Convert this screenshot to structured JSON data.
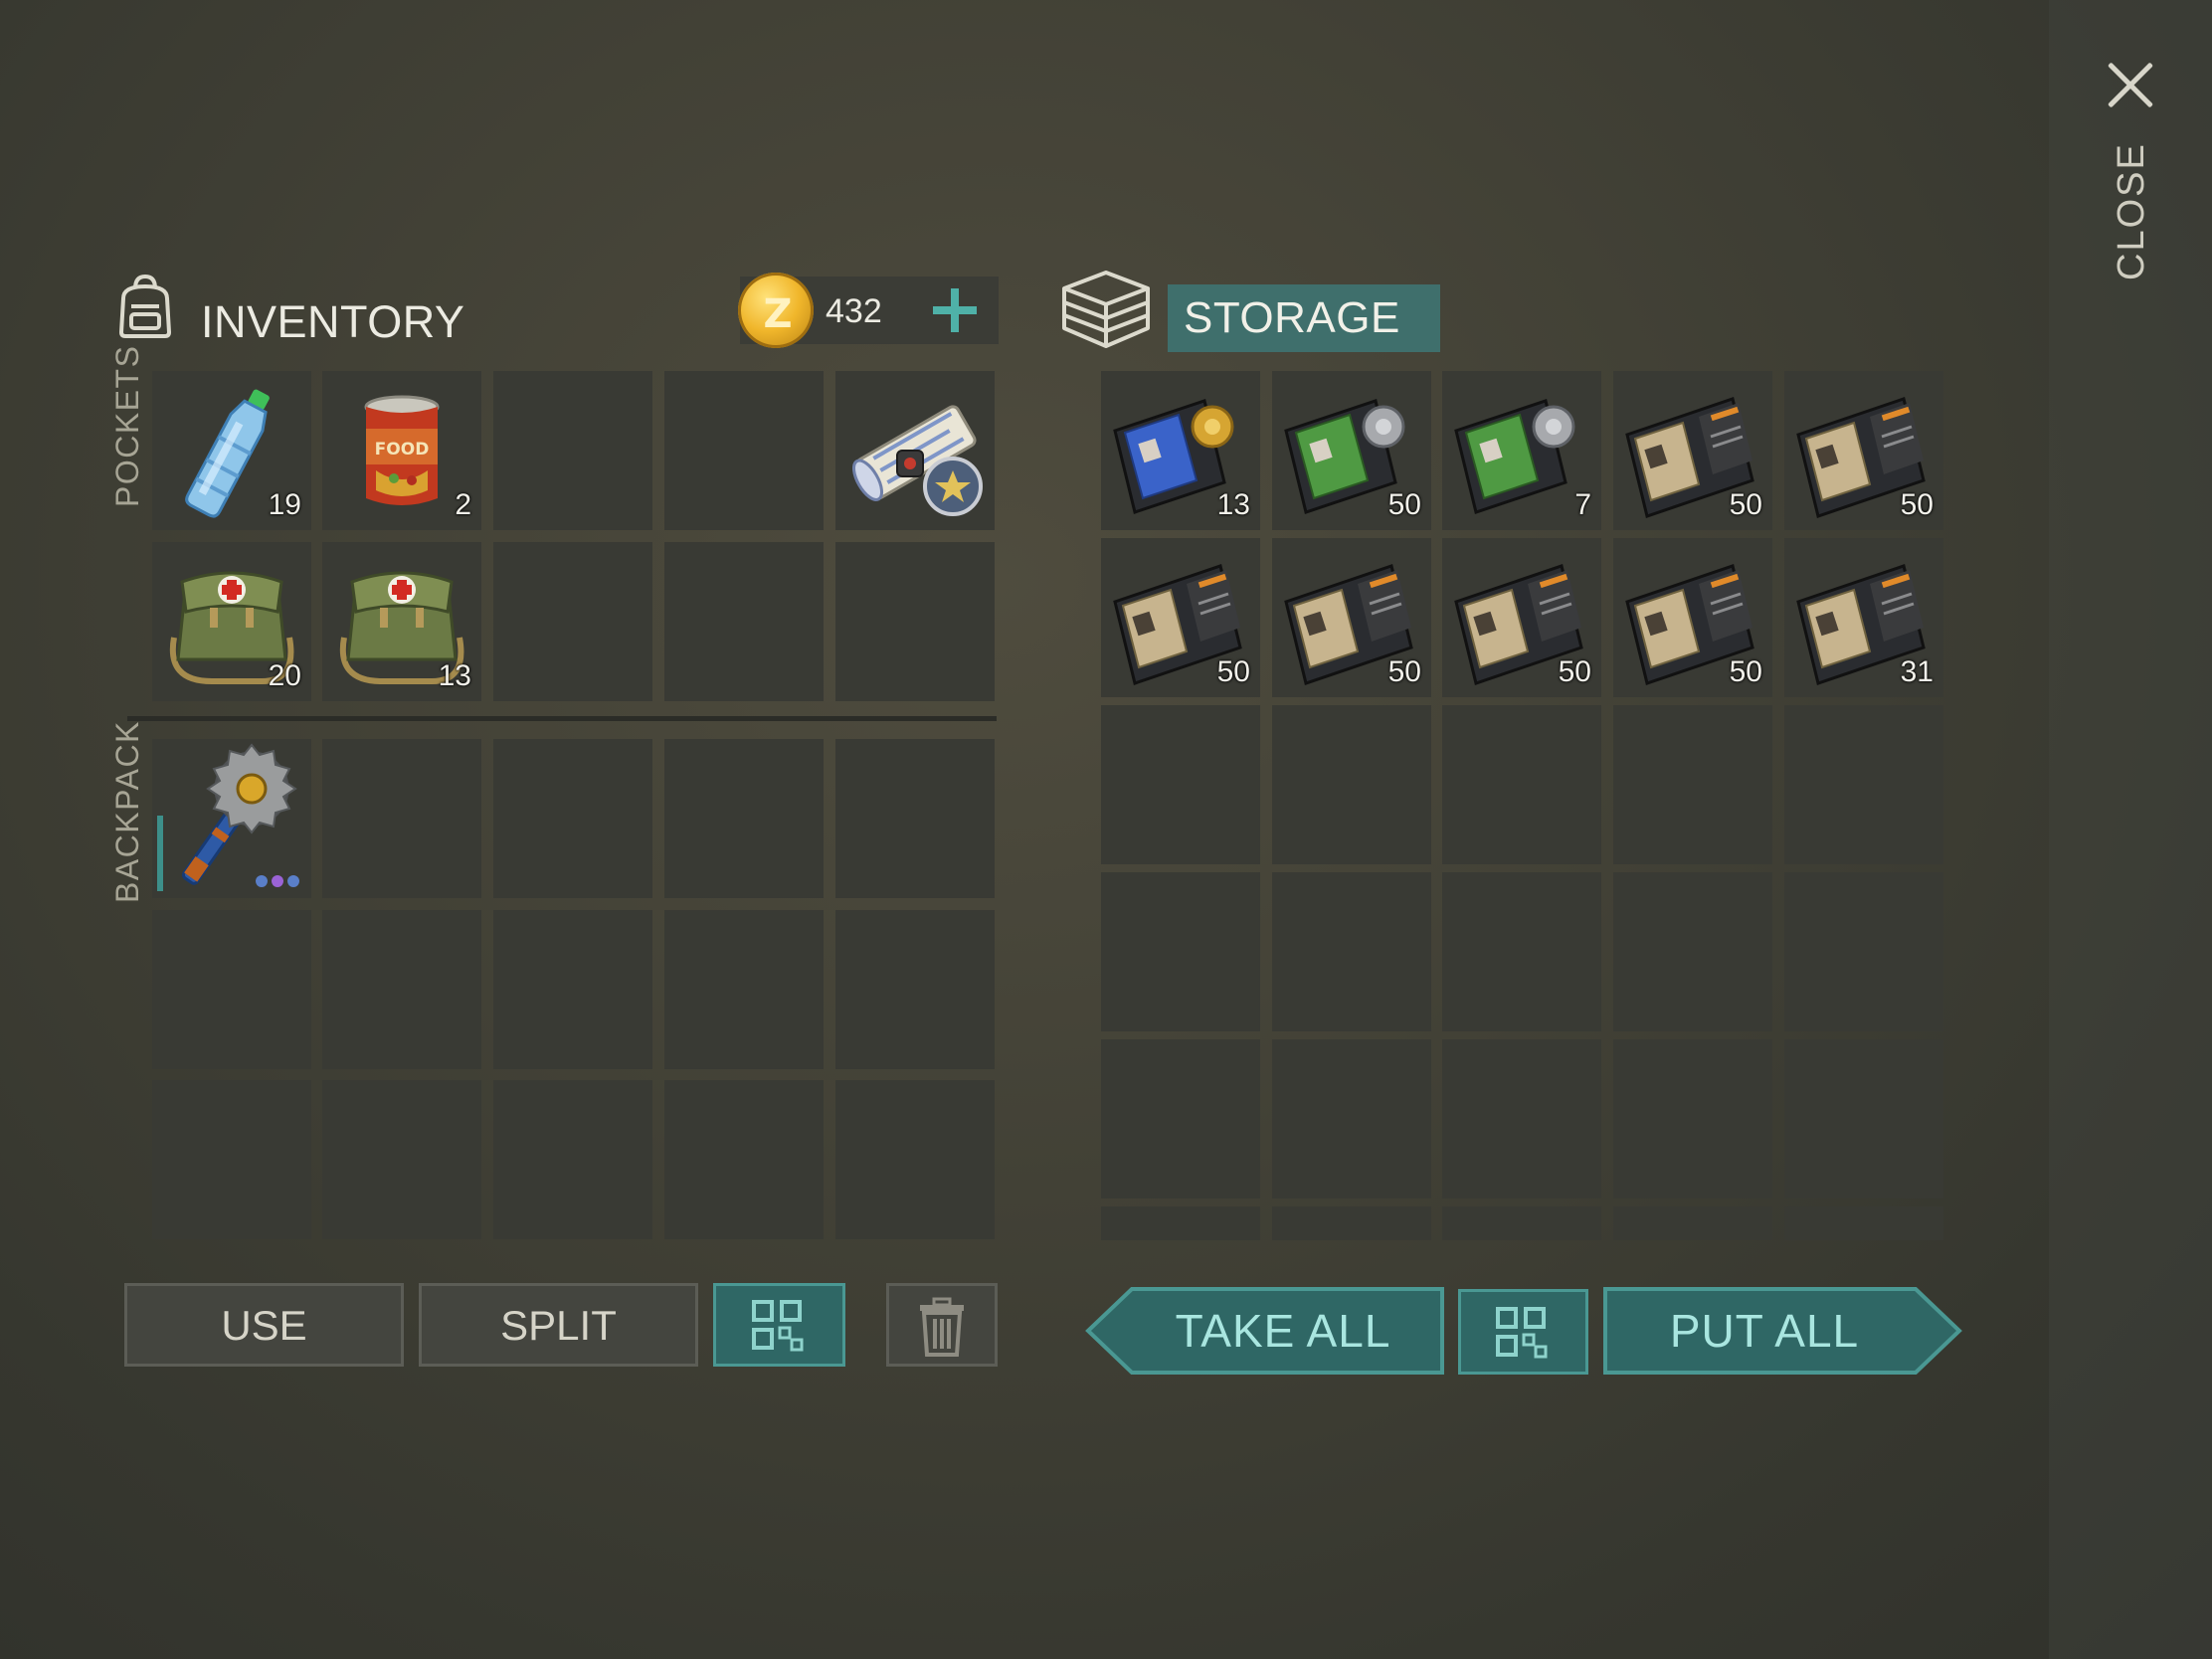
{
  "close": {
    "label": "CLOSE",
    "icon": "close-icon"
  },
  "inventory": {
    "title": "INVENTORY",
    "icon": "backpack-icon",
    "currency": {
      "amount": "432",
      "icon": "zed-coin-icon",
      "add_icon": "plus-icon"
    },
    "pockets_label": "POCKETS",
    "backpack_label": "BACKPACK",
    "pockets": [
      {
        "item": "water-bottle",
        "count": "19"
      },
      {
        "item": "canned-food",
        "count": "2"
      },
      {
        "item": "",
        "count": ""
      },
      {
        "item": "",
        "count": ""
      },
      {
        "item": "police-map",
        "count": ""
      },
      {
        "item": "first-aid-bag",
        "count": "20"
      },
      {
        "item": "first-aid-bag",
        "count": "13"
      },
      {
        "item": "",
        "count": ""
      },
      {
        "item": "",
        "count": ""
      },
      {
        "item": "",
        "count": ""
      }
    ],
    "backpack": [
      {
        "item": "sawblade-mace",
        "count": "",
        "durability": 0.7
      }
    ]
  },
  "storage": {
    "title": "STORAGE",
    "icon": "storage-box-icon",
    "items": [
      {
        "item": "police-badge-id-blue",
        "count": "13"
      },
      {
        "item": "police-badge-id-green",
        "count": "50"
      },
      {
        "item": "police-badge-id-green",
        "count": "7"
      },
      {
        "item": "patrol-officer-id",
        "count": "50"
      },
      {
        "item": "patrol-officer-id",
        "count": "50"
      },
      {
        "item": "patrol-officer-id",
        "count": "50"
      },
      {
        "item": "patrol-officer-id",
        "count": "50"
      },
      {
        "item": "patrol-officer-id",
        "count": "50"
      },
      {
        "item": "patrol-officer-id",
        "count": "50"
      },
      {
        "item": "patrol-officer-id",
        "count": "31"
      }
    ]
  },
  "buttons": {
    "use": "USE",
    "split": "SPLIT",
    "sort_icon": "sort-grid-icon",
    "trash_icon": "trash-icon",
    "take_all": "TAKE ALL",
    "put_all": "PUT ALL"
  },
  "colors": {
    "accent": "#4fb1a8",
    "button_teal": "#2f6765",
    "slot": "#393a34",
    "coin": "#f0b62b"
  }
}
